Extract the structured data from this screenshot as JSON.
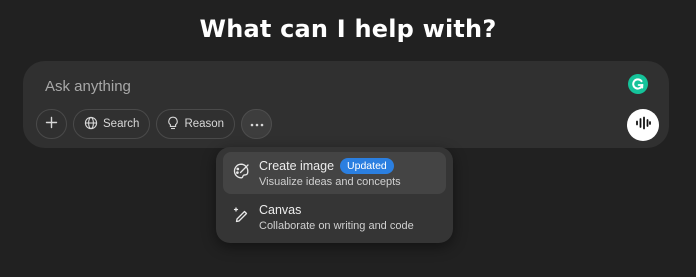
{
  "title": "What can I help with?",
  "composer": {
    "placeholder": "Ask anything",
    "extension_icon": "grammarly-icon",
    "buttons": [
      {
        "icon": "plus-icon",
        "label": ""
      },
      {
        "icon": "globe-icon",
        "label": "Search"
      },
      {
        "icon": "lightbulb-icon",
        "label": "Reason"
      },
      {
        "icon": "ellipsis-icon",
        "label": ""
      }
    ],
    "voice_icon": "voice-waveform-icon"
  },
  "menu": {
    "items": [
      {
        "icon": "palette-icon",
        "title": "Create image",
        "badge": "Updated",
        "description": "Visualize ideas and concepts",
        "highlighted": true
      },
      {
        "icon": "pen-sparkle-icon",
        "title": "Canvas",
        "badge": "",
        "description": "Collaborate on writing and code",
        "highlighted": false
      }
    ]
  },
  "colors": {
    "background": "#212121",
    "composer": "#303030",
    "menu": "#353535",
    "badge": "#2b7fe0",
    "grammarly": "#15c39a"
  }
}
